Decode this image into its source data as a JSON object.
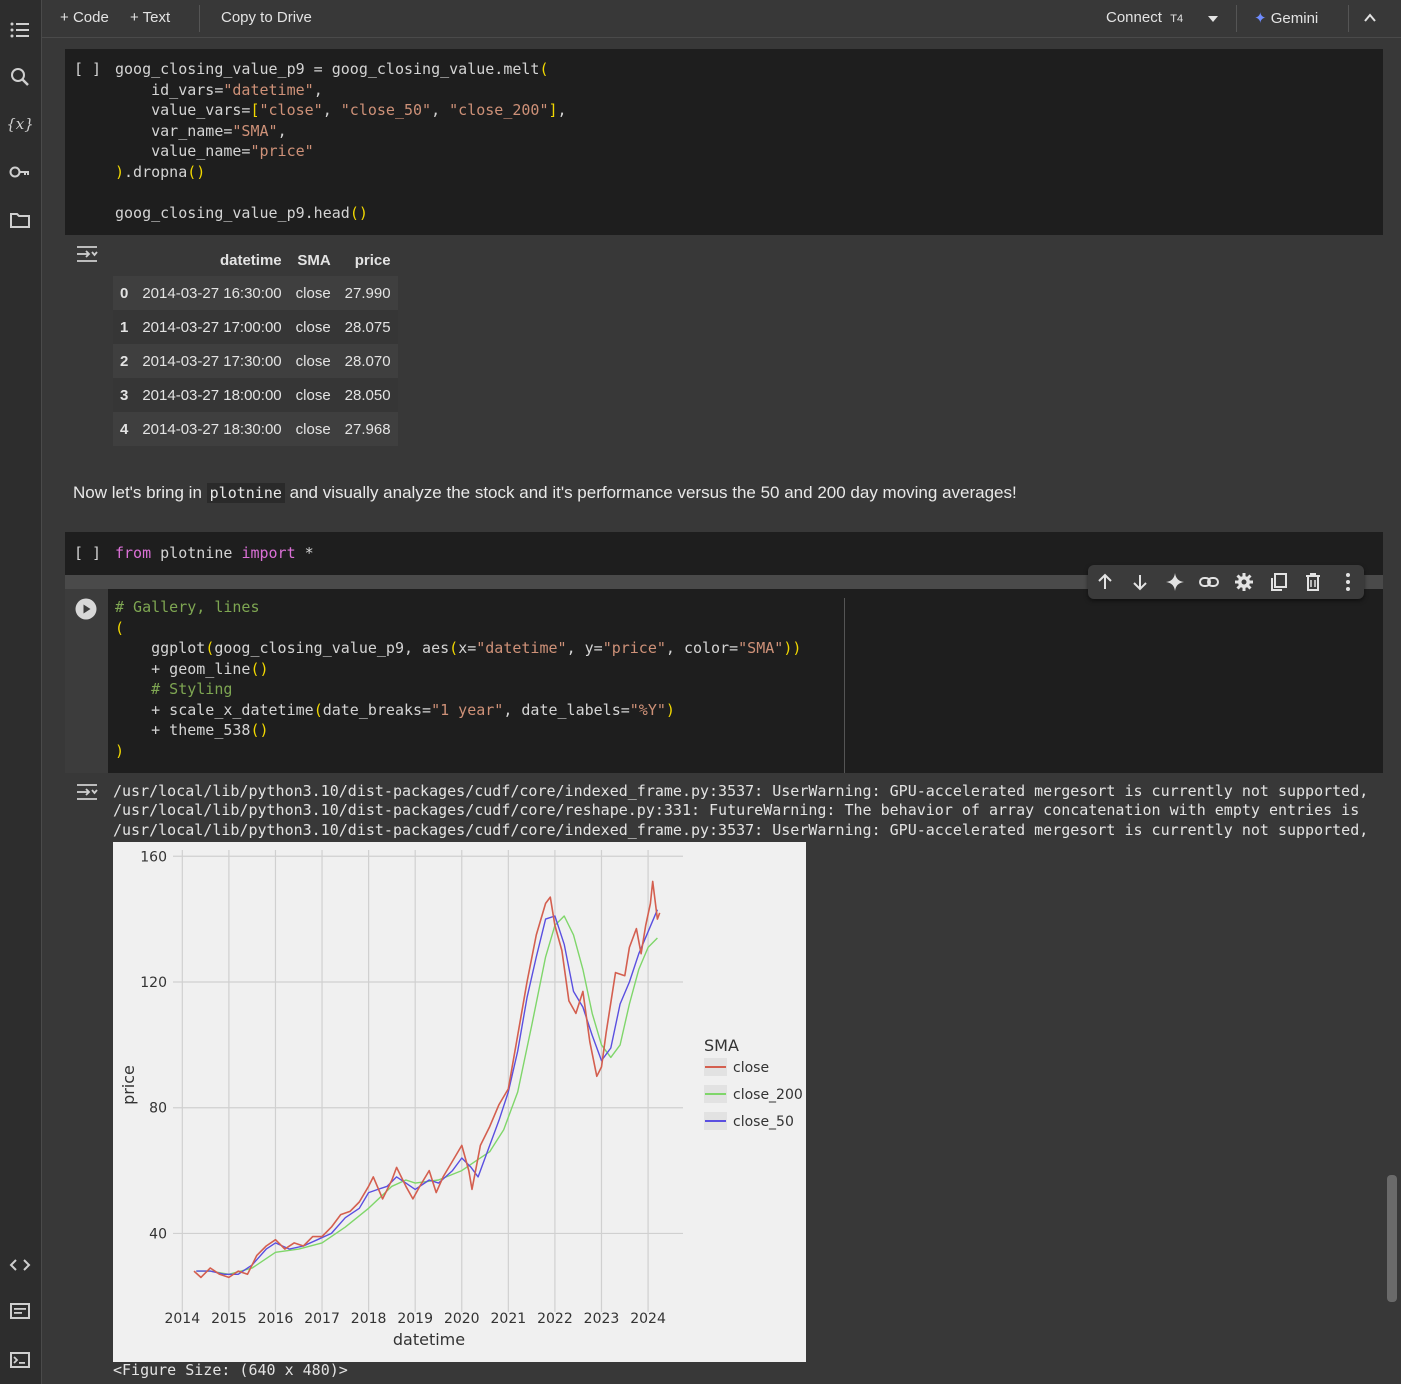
{
  "topbar": {
    "code_label": "Code",
    "text_label": "Text",
    "copy_label": "Copy to Drive",
    "connect_label": "Connect",
    "runtime_label": "T4",
    "gemini_label": "Gemini"
  },
  "cell1": {
    "bracket": "[ ]",
    "lines": [
      "goog_closing_value_p9 = goog_closing_value.melt(",
      "    id_vars=\"datetime\",",
      "    value_vars=[\"close\", \"close_50\", \"close_200\"],",
      "    var_name=\"SMA\",",
      "    value_name=\"price\"",
      ").dropna()",
      "",
      "goog_closing_value_p9.head()"
    ]
  },
  "table": {
    "columns": [
      "",
      "datetime",
      "SMA",
      "price"
    ],
    "rows": [
      [
        "0",
        "2014-03-27 16:30:00",
        "close",
        "27.990"
      ],
      [
        "1",
        "2014-03-27 17:00:00",
        "close",
        "28.075"
      ],
      [
        "2",
        "2014-03-27 17:30:00",
        "close",
        "28.070"
      ],
      [
        "3",
        "2014-03-27 18:00:00",
        "close",
        "28.050"
      ],
      [
        "4",
        "2014-03-27 18:30:00",
        "close",
        "27.968"
      ]
    ]
  },
  "markdown": {
    "before": "Now let's bring in ",
    "code": "plotnine",
    "after": " and visually analyze the stock and it's performance versus the 50 and 200 day moving averages!"
  },
  "cell2": {
    "bracket": "[ ]",
    "line": "from plotnine import *"
  },
  "cell3": {
    "lines": [
      "# Gallery, lines",
      "(",
      "    ggplot(goog_closing_value_p9, aes(x=\"datetime\", y=\"price\", color=\"SMA\"))",
      "    + geom_line()",
      "    # Styling",
      "    + scale_x_datetime(date_breaks=\"1 year\", date_labels=\"%Y\")",
      "    + theme_538()",
      ")"
    ]
  },
  "warnings": [
    "/usr/local/lib/python3.10/dist-packages/cudf/core/indexed_frame.py:3537: UserWarning: GPU-accelerated mergesort is currently not supported,",
    "/usr/local/lib/python3.10/dist-packages/cudf/core/reshape.py:331: FutureWarning: The behavior of array concatenation with empty entries is",
    "/usr/local/lib/python3.10/dist-packages/cudf/core/indexed_frame.py:3537: UserWarning: GPU-accelerated mergesort is currently not supported,"
  ],
  "figure_size": "<Figure Size: (640 x 480)>",
  "colors": {
    "close": "#d45f4f",
    "close_200": "#7fd66a",
    "close_50": "#5a4fe0",
    "plot_bg": "#f0f0f0",
    "grid": "#d0d0d0"
  },
  "chart_data": {
    "type": "line",
    "xlabel": "datetime",
    "ylabel": "price",
    "ylim": [
      15,
      162
    ],
    "xlim": [
      2013.8,
      2024.75
    ],
    "x_ticks": [
      "2014",
      "2015",
      "2016",
      "2017",
      "2018",
      "2019",
      "2020",
      "2021",
      "2022",
      "2023",
      "2024"
    ],
    "y_ticks": [
      40,
      80,
      120,
      160
    ],
    "legend_title": "SMA",
    "legend_position": "right",
    "series": [
      {
        "name": "close",
        "points": [
          [
            2014.25,
            28
          ],
          [
            2014.4,
            26
          ],
          [
            2014.6,
            29
          ],
          [
            2014.8,
            27
          ],
          [
            2015.0,
            26
          ],
          [
            2015.2,
            28
          ],
          [
            2015.4,
            27
          ],
          [
            2015.6,
            33
          ],
          [
            2015.8,
            36
          ],
          [
            2016.0,
            38
          ],
          [
            2016.2,
            35
          ],
          [
            2016.4,
            37
          ],
          [
            2016.6,
            36
          ],
          [
            2016.8,
            39
          ],
          [
            2017.0,
            39
          ],
          [
            2017.2,
            42
          ],
          [
            2017.4,
            46
          ],
          [
            2017.6,
            47
          ],
          [
            2017.8,
            50
          ],
          [
            2018.0,
            55
          ],
          [
            2018.1,
            58
          ],
          [
            2018.3,
            51
          ],
          [
            2018.5,
            57
          ],
          [
            2018.6,
            61
          ],
          [
            2018.8,
            55
          ],
          [
            2018.95,
            51
          ],
          [
            2019.1,
            55
          ],
          [
            2019.3,
            60
          ],
          [
            2019.45,
            53
          ],
          [
            2019.6,
            58
          ],
          [
            2019.8,
            63
          ],
          [
            2020.0,
            68
          ],
          [
            2020.15,
            60
          ],
          [
            2020.22,
            54
          ],
          [
            2020.4,
            68
          ],
          [
            2020.6,
            74
          ],
          [
            2020.8,
            81
          ],
          [
            2021.0,
            86
          ],
          [
            2021.2,
            103
          ],
          [
            2021.4,
            120
          ],
          [
            2021.6,
            135
          ],
          [
            2021.8,
            145
          ],
          [
            2021.9,
            147
          ],
          [
            2022.0,
            138
          ],
          [
            2022.15,
            130
          ],
          [
            2022.3,
            114
          ],
          [
            2022.45,
            110
          ],
          [
            2022.6,
            117
          ],
          [
            2022.75,
            101
          ],
          [
            2022.9,
            90
          ],
          [
            2023.0,
            93
          ],
          [
            2023.1,
            104
          ],
          [
            2023.3,
            123
          ],
          [
            2023.5,
            122
          ],
          [
            2023.6,
            131
          ],
          [
            2023.75,
            137
          ],
          [
            2023.85,
            129
          ],
          [
            2023.95,
            138
          ],
          [
            2024.05,
            145
          ],
          [
            2024.1,
            152
          ],
          [
            2024.2,
            140
          ],
          [
            2024.25,
            142
          ]
        ]
      },
      {
        "name": "close_200",
        "points": [
          [
            2014.3,
            28
          ],
          [
            2014.6,
            28
          ],
          [
            2015.0,
            27
          ],
          [
            2015.5,
            29
          ],
          [
            2016.0,
            34
          ],
          [
            2016.5,
            35
          ],
          [
            2017.0,
            37
          ],
          [
            2017.5,
            42
          ],
          [
            2018.0,
            48
          ],
          [
            2018.5,
            55
          ],
          [
            2018.8,
            57
          ],
          [
            2019.0,
            56
          ],
          [
            2019.5,
            57
          ],
          [
            2020.0,
            60
          ],
          [
            2020.3,
            63
          ],
          [
            2020.6,
            66
          ],
          [
            2020.9,
            73
          ],
          [
            2021.2,
            85
          ],
          [
            2021.5,
            106
          ],
          [
            2021.8,
            128
          ],
          [
            2022.0,
            138
          ],
          [
            2022.2,
            141
          ],
          [
            2022.4,
            135
          ],
          [
            2022.6,
            124
          ],
          [
            2022.8,
            110
          ],
          [
            2023.0,
            100
          ],
          [
            2023.2,
            96
          ],
          [
            2023.4,
            100
          ],
          [
            2023.6,
            113
          ],
          [
            2023.8,
            124
          ],
          [
            2024.0,
            131
          ],
          [
            2024.2,
            134
          ]
        ]
      },
      {
        "name": "close_50",
        "points": [
          [
            2014.3,
            28
          ],
          [
            2014.6,
            28
          ],
          [
            2014.9,
            27
          ],
          [
            2015.2,
            27
          ],
          [
            2015.5,
            30
          ],
          [
            2015.8,
            35
          ],
          [
            2016.0,
            37
          ],
          [
            2016.3,
            35
          ],
          [
            2016.6,
            36
          ],
          [
            2016.9,
            38
          ],
          [
            2017.2,
            40
          ],
          [
            2017.5,
            45
          ],
          [
            2017.8,
            48
          ],
          [
            2018.0,
            53
          ],
          [
            2018.2,
            54
          ],
          [
            2018.4,
            55
          ],
          [
            2018.6,
            58
          ],
          [
            2018.8,
            56
          ],
          [
            2019.0,
            54
          ],
          [
            2019.3,
            57
          ],
          [
            2019.5,
            56
          ],
          [
            2019.8,
            60
          ],
          [
            2020.0,
            64
          ],
          [
            2020.2,
            61
          ],
          [
            2020.35,
            58
          ],
          [
            2020.6,
            68
          ],
          [
            2020.8,
            76
          ],
          [
            2021.0,
            85
          ],
          [
            2021.2,
            98
          ],
          [
            2021.4,
            115
          ],
          [
            2021.6,
            128
          ],
          [
            2021.8,
            140
          ],
          [
            2022.0,
            141
          ],
          [
            2022.2,
            132
          ],
          [
            2022.4,
            117
          ],
          [
            2022.6,
            112
          ],
          [
            2022.8,
            103
          ],
          [
            2023.0,
            95
          ],
          [
            2023.2,
            99
          ],
          [
            2023.4,
            113
          ],
          [
            2023.6,
            120
          ],
          [
            2023.8,
            129
          ],
          [
            2024.0,
            136
          ],
          [
            2024.2,
            143
          ]
        ]
      }
    ]
  }
}
